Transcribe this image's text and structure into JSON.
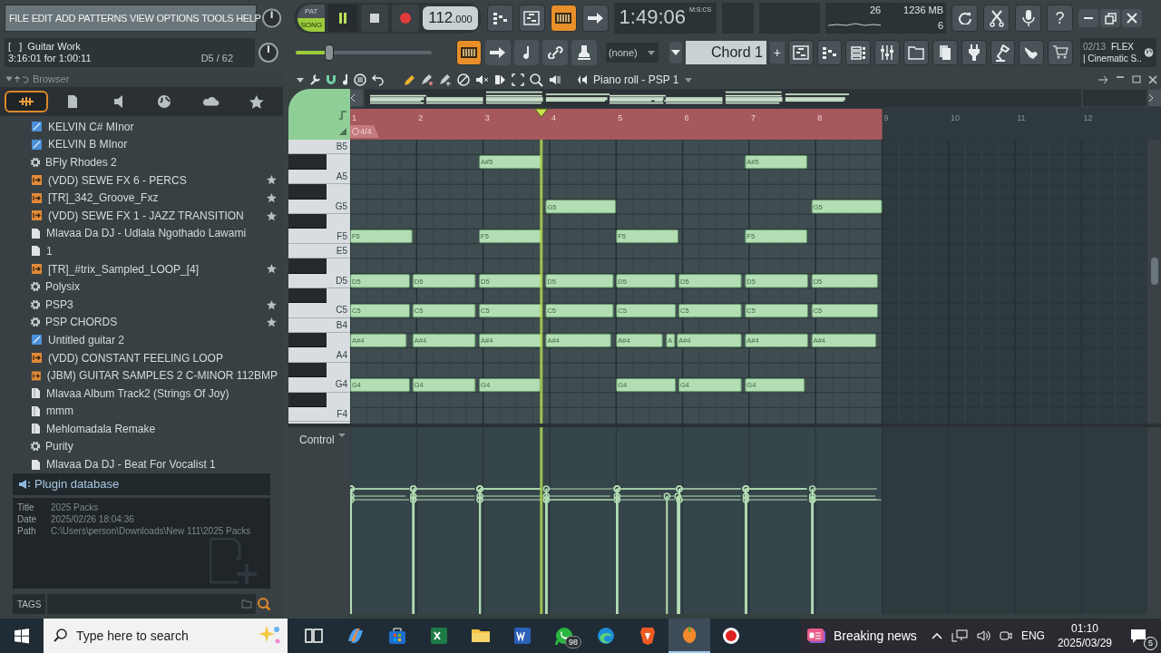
{
  "menu": [
    "FILE",
    "EDIT",
    "ADD",
    "PATTERNS",
    "VIEW",
    "OPTIONS",
    "TOOLS",
    "HELP"
  ],
  "transport": {
    "modes": [
      {
        "label": "PAT",
        "selected": false
      },
      {
        "label": "SONG",
        "selected": true
      }
    ],
    "playing": true,
    "tempo": "112",
    "tempo_fraction": ".000"
  },
  "time": {
    "value": "1:49:06",
    "format": "M:S:CS"
  },
  "monitor": {
    "cpu": "26",
    "memory": "1236 MB",
    "polyphony": "6"
  },
  "help_glyph": "?",
  "hint": {
    "bracket": "[   ]",
    "title": "Guitar Work",
    "position": "3:16:01 for 1:00:11",
    "note": "D5 / 62"
  },
  "master": {
    "level": 0.25
  },
  "snap": "(none)",
  "pattern": "Chord 1",
  "add_glyph": "+",
  "news": {
    "index": "02/13",
    "tag": "FLEX",
    "text": "| Cinematic S.."
  },
  "browser": {
    "title": "Browser",
    "tabs": [
      {
        "kind": "all",
        "selected": true
      },
      {
        "kind": "files",
        "selected": false
      },
      {
        "kind": "plugins",
        "selected": false
      },
      {
        "kind": "web",
        "selected": false
      },
      {
        "kind": "cloud",
        "selected": false
      },
      {
        "kind": "favorites",
        "selected": false
      }
    ],
    "items": [
      {
        "kind": "score",
        "label": "KELVIN C# MInor",
        "starred": false
      },
      {
        "kind": "score",
        "label": "KELVIN B MInor",
        "starred": false
      },
      {
        "kind": "plugin",
        "label": "BFly Rhodes 2",
        "starred": false
      },
      {
        "kind": "loop",
        "label": "(VDD) SEWE FX 6 - PERCS",
        "starred": true
      },
      {
        "kind": "loop",
        "label": "[TR]_342_Groove_Fxz",
        "starred": true
      },
      {
        "kind": "loop",
        "label": "(VDD) SEWE FX 1 - JAZZ TRANSITION",
        "starred": true
      },
      {
        "kind": "file",
        "label": "Mlavaa Da DJ - Udlala Ngothado Lawami",
        "starred": false
      },
      {
        "kind": "file",
        "label": "1",
        "starred": false
      },
      {
        "kind": "loop",
        "label": "[TR]_#trix_Sampled_LOOP_[4]",
        "starred": true
      },
      {
        "kind": "plugin",
        "label": "Polysix",
        "starred": false
      },
      {
        "kind": "plugin",
        "label": "PSP3",
        "starred": true
      },
      {
        "kind": "plugin",
        "label": "PSP CHORDS",
        "starred": true
      },
      {
        "kind": "score",
        "label": "Untitled guitar 2",
        "starred": false
      },
      {
        "kind": "loop",
        "label": "(VDD) CONSTANT FEELING LOOP",
        "starred": false
      },
      {
        "kind": "loop",
        "label": "(JBM) GUITAR SAMPLES 2 C-MINOR 112BMP",
        "starred": false
      },
      {
        "kind": "project",
        "label": "Mlavaa Album Track2 (Strings Of Joy)",
        "starred": false
      },
      {
        "kind": "project",
        "label": "mmm",
        "starred": false
      },
      {
        "kind": "project",
        "label": "Mehlomadala Remake",
        "starred": false
      },
      {
        "kind": "plugin",
        "label": "Purity",
        "starred": false
      },
      {
        "kind": "file",
        "label": "Mlavaa Da DJ - Beat For Vocalist 1",
        "starred": false
      }
    ],
    "database": "Plugin database",
    "info": [
      {
        "label": "Title",
        "value": "2025 Packs"
      },
      {
        "label": "Date",
        "value": "2025/02/26 18:04:36"
      },
      {
        "label": "Path",
        "value": "C:\\Users\\person\\Downloads\\New 111\\2025 Packs"
      }
    ],
    "tags_label": "TAGS"
  },
  "piano_roll": {
    "title": "Piano roll - PSP 1",
    "bars": [
      "1",
      "2",
      "3",
      "4",
      "5",
      "6",
      "7",
      "8",
      "9",
      "10",
      "11",
      "12"
    ],
    "time_signature": "4/4",
    "control_label": "Control",
    "keys": [
      "B5",
      "A5",
      "G5",
      "F5",
      "E5",
      "D5",
      "C5",
      "B4",
      "A4",
      "G4",
      "F4"
    ],
    "notes": [
      {
        "label": "A#5"
      },
      {
        "label": "A#5"
      },
      {
        "label": "G5"
      },
      {
        "label": "G5"
      },
      {
        "label": "F5"
      },
      {
        "label": "F5"
      },
      {
        "label": "F5"
      },
      {
        "label": "F5"
      },
      {
        "label": "D5"
      },
      {
        "label": "D5"
      },
      {
        "label": "D5"
      },
      {
        "label": "D5"
      },
      {
        "label": "D5"
      },
      {
        "label": "D5"
      },
      {
        "label": "D5"
      },
      {
        "label": "D5"
      },
      {
        "label": "C5"
      },
      {
        "label": "C5"
      },
      {
        "label": "C5"
      },
      {
        "label": "C5"
      },
      {
        "label": "C5"
      },
      {
        "label": "C5"
      },
      {
        "label": "C5"
      },
      {
        "label": "C5"
      },
      {
        "label": "A#4"
      },
      {
        "label": "A#4"
      },
      {
        "label": "A#4"
      },
      {
        "label": "A#4"
      },
      {
        "label": "A#4"
      },
      {
        "label": "A"
      },
      {
        "label": "A#4"
      },
      {
        "label": "A#4"
      },
      {
        "label": "A#4"
      },
      {
        "label": "G4"
      },
      {
        "label": "G4"
      },
      {
        "label": "G4"
      },
      {
        "label": "G4"
      },
      {
        "label": "G4"
      },
      {
        "label": "G4"
      }
    ]
  },
  "taskbar": {
    "search_placeholder": "Type here to search",
    "apps": [
      {
        "kind": "taskview",
        "selected": false
      },
      {
        "kind": "copilot",
        "selected": false
      },
      {
        "kind": "store",
        "selected": false
      },
      {
        "kind": "sheet",
        "selected": false
      },
      {
        "kind": "folder",
        "selected": false
      },
      {
        "kind": "doc",
        "selected": false
      },
      {
        "kind": "chat",
        "selected": false,
        "badge": "98"
      },
      {
        "kind": "browser",
        "selected": false
      },
      {
        "kind": "shield",
        "selected": false
      },
      {
        "kind": "daw",
        "selected": true
      },
      {
        "kind": "record",
        "selected": false
      }
    ],
    "news": "Breaking news",
    "language": "ENG",
    "time": "01:10",
    "date": "2025/03/29",
    "notifications": "5"
  }
}
